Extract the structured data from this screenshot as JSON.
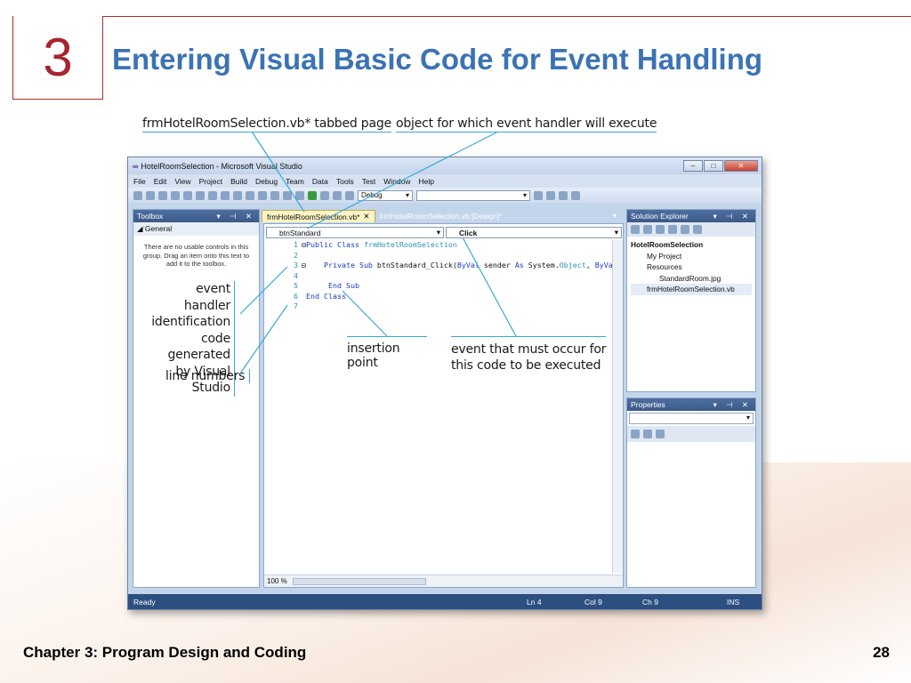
{
  "slide": {
    "number": "3",
    "title": "Entering Visual Basic Code for Event Handling",
    "footer_left": "Chapter 3: Program Design and Coding",
    "footer_right": "28"
  },
  "callouts": {
    "tabbed_page": "frmHotelRoomSelection.vb* tabbed page",
    "object": "object for which event handler will execute",
    "event_handler_1": "event handler",
    "event_handler_2": "identification",
    "event_handler_3": "code generated",
    "event_handler_4": "by Visual Studio",
    "line_numbers": "line numbers",
    "insertion_point": "insertion point",
    "event_1": "event that must occur for",
    "event_2": "this code to be executed"
  },
  "window": {
    "title": "HotelRoomSelection - Microsoft Visual Studio",
    "menu": [
      "File",
      "Edit",
      "View",
      "Project",
      "Build",
      "Debug",
      "Team",
      "Data",
      "Tools",
      "Test",
      "Window",
      "Help"
    ],
    "config": "Debug"
  },
  "toolbox": {
    "title": "Toolbox",
    "group": "◢ General",
    "message": "There are no usable controls in this group. Drag an item onto this text to add it to the toolbox."
  },
  "editor": {
    "tab_active": "frmHotelRoomSelection.vb*",
    "tab_inactive": "frmHotelRoomSelection.vb [Design]*",
    "object_combo": "btnStandard",
    "event_combo": "Click",
    "lines": [
      "1",
      "2",
      "3",
      "4",
      "5",
      "6",
      "7"
    ],
    "zoom": "100 %"
  },
  "solution": {
    "title": "Solution Explorer",
    "project": "HotelRoomSelection",
    "items": [
      "My Project",
      "Resources",
      "StandardRoom.jpg",
      "frmHotelRoomSelection.vb"
    ]
  },
  "properties": {
    "title": "Properties"
  },
  "status": {
    "ready": "Ready",
    "ln": "Ln 4",
    "col": "Col 9",
    "ch": "Ch 9",
    "ins": "INS"
  },
  "colors": {
    "accent": "#3b73b4",
    "number": "#a8232f",
    "callout_line": "#38a9d8"
  }
}
